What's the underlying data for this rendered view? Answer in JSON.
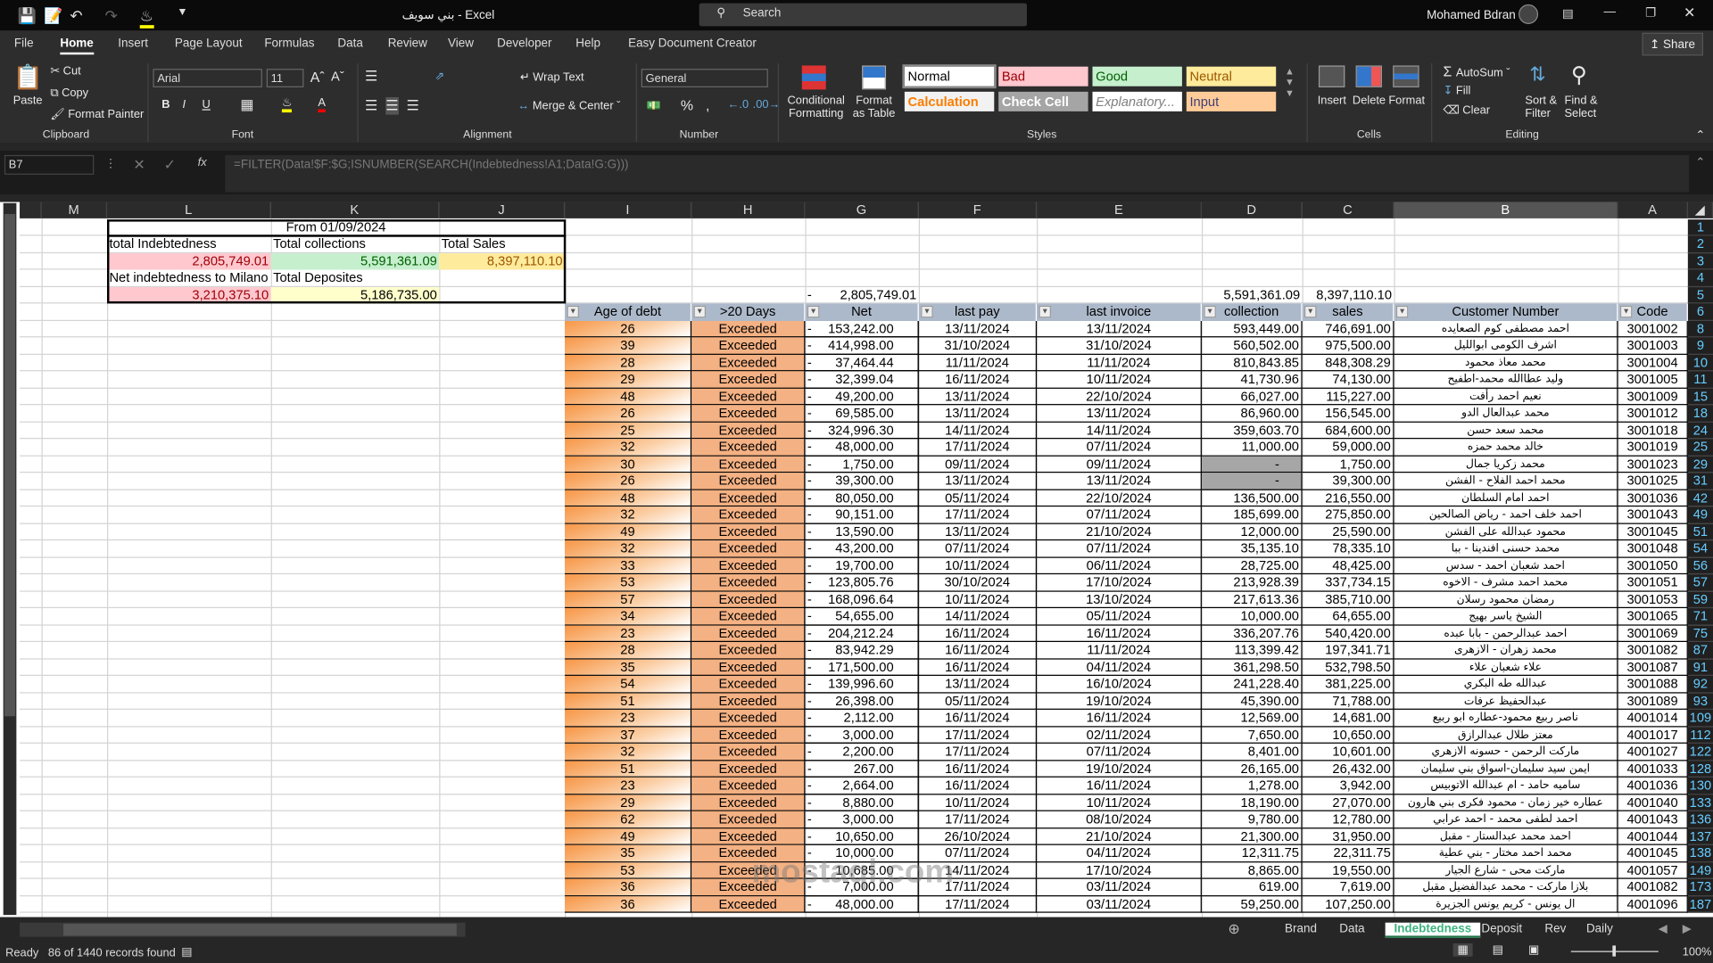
{
  "window": {
    "title": "بني سويف  -  Excel",
    "search_placeholder": "Search",
    "user": "Mohamed Bdran"
  },
  "menu": [
    "File",
    "Home",
    "Insert",
    "Page Layout",
    "Formulas",
    "Data",
    "Review",
    "View",
    "Developer",
    "Help",
    "Easy Document Creator"
  ],
  "share": "Share",
  "ribbon": {
    "clipboard": {
      "paste": "Paste",
      "cut": "Cut",
      "copy": "Copy",
      "format_painter": "Format Painter",
      "label": "Clipboard"
    },
    "font": {
      "name": "Arial",
      "size": "11",
      "label": "Font"
    },
    "alignment": {
      "wrap": "Wrap Text",
      "merge": "Merge & Center",
      "label": "Alignment"
    },
    "number": {
      "format": "General",
      "label": "Number"
    },
    "styles": {
      "conditional": "Conditional Formatting",
      "format_table": "Format as Table",
      "label": "Styles",
      "cells": [
        {
          "t": "Normal",
          "bg": "#ffffff",
          "fg": "#000000"
        },
        {
          "t": "Bad",
          "bg": "#ffc7ce",
          "fg": "#9c0006"
        },
        {
          "t": "Good",
          "bg": "#c6efce",
          "fg": "#006100"
        },
        {
          "t": "Neutral",
          "bg": "#ffeb9c",
          "fg": "#9c5700"
        },
        {
          "t": "Calculation",
          "bg": "#f2f2f2",
          "fg": "#fa7d00"
        },
        {
          "t": "Check Cell",
          "bg": "#a5a5a5",
          "fg": "#ffffff"
        },
        {
          "t": "Explanatory...",
          "bg": "#ffffff",
          "fg": "#7f7f7f"
        },
        {
          "t": "Input",
          "bg": "#ffcc99",
          "fg": "#3f3f76"
        }
      ]
    },
    "cells": {
      "insert": "Insert",
      "delete": "Delete",
      "format": "Format",
      "label": "Cells"
    },
    "editing": {
      "autosum": "AutoSum",
      "fill": "Fill",
      "clear": "Clear",
      "sort": "Sort & Filter",
      "find": "Find & Select",
      "label": "Editing"
    }
  },
  "formula_bar": {
    "name_box": "B7",
    "formula": "=FILTER(Data!$F:$G;ISNUMBER(SEARCH(Indebtedness!A1;Data!G:G)))"
  },
  "columns": [
    "M",
    "L",
    "K",
    "J",
    "I",
    "H",
    "G",
    "F",
    "E",
    "D",
    "C",
    "B",
    "A"
  ],
  "summary": {
    "from": "From 01/09/2024",
    "total_indebtedness_label": "total Indebtedness",
    "total_indebtedness": "2,805,749.01",
    "total_collections_label": "Total collections",
    "total_collections": "5,591,361.09",
    "total_sales_label": "Total Sales",
    "total_sales": "8,397,110.10",
    "net_milano_label": "Net indebtedness to Milano",
    "net_milano": "3,210,375.10",
    "total_deposits_label": "Total Deposites",
    "total_deposits": "5,186,735.00"
  },
  "totals": {
    "net_dash": "-",
    "net": "2,805,749.01",
    "collection": "5,591,361.09",
    "sales": "8,397,110.10"
  },
  "table": {
    "headers": {
      "code": "Code",
      "customer": "Customer Number",
      "sales": "sales",
      "collection": "collection",
      "last_invoice": "last invoice",
      "last_pay": "last pay",
      "net": "Net",
      "over20": ">20 Days",
      "age": "Age of debt"
    },
    "rows": [
      [
        "8",
        "3001002",
        "احمد مصطفى كوم الصعايده",
        "746,691.00",
        "593,449.00",
        "13/11/2024",
        "13/11/2024",
        "153,242.00",
        "Exceeded",
        "26"
      ],
      [
        "9",
        "3001003",
        "اشرف الكومى ابوالليل",
        "975,500.00",
        "560,502.00",
        "31/10/2024",
        "31/10/2024",
        "414,998.00",
        "Exceeded",
        "39"
      ],
      [
        "10",
        "3001004",
        "محمد معاذ محمود",
        "848,308.29",
        "810,843.85",
        "11/11/2024",
        "11/11/2024",
        "37,464.44",
        "Exceeded",
        "28"
      ],
      [
        "11",
        "3001005",
        "وليد عطاالله محمد-اطفيح",
        "74,130.00",
        "41,730.96",
        "10/11/2024",
        "16/11/2024",
        "32,399.04",
        "Exceeded",
        "29"
      ],
      [
        "15",
        "3001009",
        "نعيم احمد رأفت",
        "115,227.00",
        "66,027.00",
        "22/10/2024",
        "13/11/2024",
        "49,200.00",
        "Exceeded",
        "48"
      ],
      [
        "18",
        "3001012",
        "محمد عبدالعال الدو",
        "156,545.00",
        "86,960.00",
        "13/11/2024",
        "13/11/2024",
        "69,585.00",
        "Exceeded",
        "26"
      ],
      [
        "24",
        "3001018",
        "محمد سعد حسن",
        "684,600.00",
        "359,603.70",
        "14/11/2024",
        "14/11/2024",
        "324,996.30",
        "Exceeded",
        "25"
      ],
      [
        "25",
        "3001019",
        "خالد محمد حمزه",
        "59,000.00",
        "11,000.00",
        "07/11/2024",
        "17/11/2024",
        "48,000.00",
        "Exceeded",
        "32"
      ],
      [
        "29",
        "3001023",
        "محمد زكريا جمال",
        "1,750.00",
        "-",
        "09/11/2024",
        "09/11/2024",
        "1,750.00",
        "Exceeded",
        "30"
      ],
      [
        "31",
        "3001025",
        "محمد احمد الفلاح - الفشن",
        "39,300.00",
        "-",
        "13/11/2024",
        "13/11/2024",
        "39,300.00",
        "Exceeded",
        "26"
      ],
      [
        "42",
        "3001036",
        "احمد امام السلطان",
        "216,550.00",
        "136,500.00",
        "22/10/2024",
        "05/11/2024",
        "80,050.00",
        "Exceeded",
        "48"
      ],
      [
        "49",
        "3001043",
        "احمد خلف احمد - رياض الصالحين",
        "275,850.00",
        "185,699.00",
        "07/11/2024",
        "17/11/2024",
        "90,151.00",
        "Exceeded",
        "32"
      ],
      [
        "51",
        "3001045",
        "محمود عبدالله على الفشن",
        "25,590.00",
        "12,000.00",
        "21/10/2024",
        "13/11/2024",
        "13,590.00",
        "Exceeded",
        "49"
      ],
      [
        "54",
        "3001048",
        "محمد حسنى افندينا - ببا",
        "78,335.10",
        "35,135.10",
        "07/11/2024",
        "07/11/2024",
        "43,200.00",
        "Exceeded",
        "32"
      ],
      [
        "56",
        "3001050",
        "احمد شعبان احمد - سدس",
        "48,425.00",
        "28,725.00",
        "06/11/2024",
        "10/11/2024",
        "19,700.00",
        "Exceeded",
        "33"
      ],
      [
        "57",
        "3001051",
        "محمد احمد مشرف - الاخوه",
        "337,734.15",
        "213,928.39",
        "17/10/2024",
        "30/10/2024",
        "123,805.76",
        "Exceeded",
        "53"
      ],
      [
        "59",
        "3001053",
        "رمضان محمود رسلان",
        "385,710.00",
        "217,613.36",
        "13/10/2024",
        "10/11/2024",
        "168,096.64",
        "Exceeded",
        "57"
      ],
      [
        "71",
        "3001065",
        "الشيخ ياسر بهيج",
        "64,655.00",
        "10,000.00",
        "05/11/2024",
        "14/11/2024",
        "54,655.00",
        "Exceeded",
        "34"
      ],
      [
        "75",
        "3001069",
        "احمد عبدالرحمن - بابا عبده",
        "540,420.00",
        "336,207.76",
        "16/11/2024",
        "16/11/2024",
        "204,212.24",
        "Exceeded",
        "23"
      ],
      [
        "87",
        "3001082",
        "محمد زهران - الازهرى",
        "197,341.71",
        "113,399.42",
        "11/11/2024",
        "16/11/2024",
        "83,942.29",
        "Exceeded",
        "28"
      ],
      [
        "91",
        "3001087",
        "علاء شعبان علاء",
        "532,798.50",
        "361,298.50",
        "04/11/2024",
        "16/11/2024",
        "171,500.00",
        "Exceeded",
        "35"
      ],
      [
        "92",
        "3001088",
        "عبدالله طه البكري",
        "381,225.00",
        "241,228.40",
        "16/10/2024",
        "13/11/2024",
        "139,996.60",
        "Exceeded",
        "54"
      ],
      [
        "93",
        "3001089",
        "عبدالحفيظ عرفات",
        "71,788.00",
        "45,390.00",
        "19/10/2024",
        "05/11/2024",
        "26,398.00",
        "Exceeded",
        "51"
      ],
      [
        "109",
        "4001014",
        "ناصر ربيع محمود-عطاره ابو ربيع",
        "14,681.00",
        "12,569.00",
        "16/11/2024",
        "16/11/2024",
        "2,112.00",
        "Exceeded",
        "23"
      ],
      [
        "112",
        "4001017",
        "معتز طلال عبدالرازق",
        "10,650.00",
        "7,650.00",
        "02/11/2024",
        "17/11/2024",
        "3,000.00",
        "Exceeded",
        "37"
      ],
      [
        "122",
        "4001027",
        "ماركت الرحمن - حسونه الازهري",
        "10,601.00",
        "8,401.00",
        "07/11/2024",
        "17/11/2024",
        "2,200.00",
        "Exceeded",
        "32"
      ],
      [
        "128",
        "4001033",
        "ايمن سيد سليمان-اسواق بني سليمان",
        "26,432.00",
        "26,165.00",
        "19/10/2024",
        "16/11/2024",
        "267.00",
        "Exceeded",
        "51"
      ],
      [
        "130",
        "4001036",
        "ساميه حامد - ام عبدالله الاتوبيس",
        "3,942.00",
        "1,278.00",
        "16/11/2024",
        "16/11/2024",
        "2,664.00",
        "Exceeded",
        "23"
      ],
      [
        "133",
        "4001040",
        "عطاره خير زمان - محمود فكرى بني هارون",
        "27,070.00",
        "18,190.00",
        "10/11/2024",
        "10/11/2024",
        "8,880.00",
        "Exceeded",
        "29"
      ],
      [
        "136",
        "4001043",
        "احمد لطفى محمد - احمد عرابي",
        "12,780.00",
        "9,780.00",
        "08/10/2024",
        "17/11/2024",
        "3,000.00",
        "Exceeded",
        "62"
      ],
      [
        "137",
        "4001044",
        "احمد محمد عبدالستار - مقبل",
        "31,950.00",
        "21,300.00",
        "21/10/2024",
        "26/10/2024",
        "10,650.00",
        "Exceeded",
        "49"
      ],
      [
        "138",
        "4001045",
        "محمد احمد مختار - بني عطية",
        "22,311.75",
        "12,311.75",
        "04/11/2024",
        "07/11/2024",
        "10,000.00",
        "Exceeded",
        "35"
      ],
      [
        "149",
        "4001057",
        "ماركت محى - شارع الجيار",
        "19,550.00",
        "8,865.00",
        "17/10/2024",
        "14/11/2024",
        "10,685.00",
        "Exceeded",
        "53"
      ],
      [
        "173",
        "4001082",
        "بلازا ماركت - محمد عبدالفضيل مقبل",
        "7,619.00",
        "619.00",
        "03/11/2024",
        "17/11/2024",
        "7,000.00",
        "Exceeded",
        "36"
      ],
      [
        "187",
        "4001096",
        "ال يونس - كريم يونس الجزيرة",
        "107,250.00",
        "59,250.00",
        "03/11/2024",
        "17/11/2024",
        "48,000.00",
        "Exceeded",
        "36"
      ]
    ]
  },
  "sheets": [
    "Brand",
    "Data",
    "Indebtedness",
    "Deposit",
    "Rev",
    "Daily"
  ],
  "active_sheet": "Indebtedness",
  "status": {
    "ready": "Ready",
    "records": "86 of 1440 records found",
    "zoom": "100%"
  },
  "watermark": "mostaql.com",
  "colors": {
    "header_fill": "#acb9ca",
    "exceeded_fill": "#f4b183",
    "age_gradient": "#f79646",
    "bad": "#ffc7ce",
    "good": "#c6efce",
    "neutral": "#ffeb9c",
    "deposit_fill": "#ffffcc",
    "blank_collection": "#a6a6a6"
  }
}
